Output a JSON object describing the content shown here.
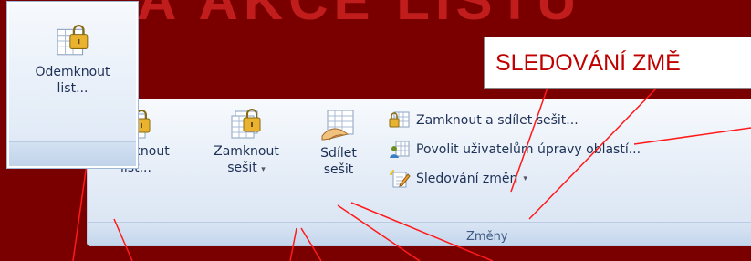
{
  "background_title": "A AKCE LISTU",
  "callout": {
    "text": "SLEDOVÁNÍ ZMĚ"
  },
  "popup": {
    "label_line1": "Odemknout",
    "label_line2": "list..."
  },
  "buttons": [
    {
      "line1": "Zamknout",
      "line2": "list..."
    },
    {
      "line1": "Zamknout",
      "line2": "sešit",
      "dropdown": "▾"
    },
    {
      "line1": "Sdílet",
      "line2": "sešit"
    }
  ],
  "small_items": [
    {
      "label": "Zamknout a sdílet sešit..."
    },
    {
      "label": "Povolit uživatelům úpravy oblastí..."
    },
    {
      "label": "Sledování změn",
      "dropdown": "▾"
    }
  ],
  "group_label": "Změny",
  "colors": {
    "background": "#7a0000",
    "callout_text": "#c00000",
    "lines": "#ff1a1a"
  }
}
